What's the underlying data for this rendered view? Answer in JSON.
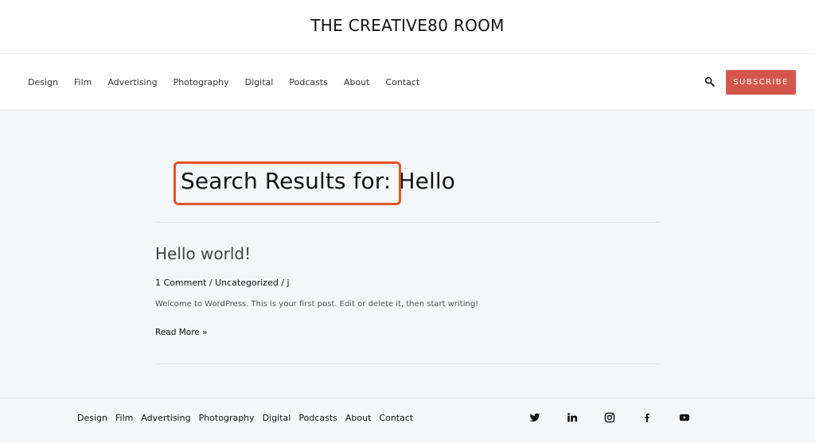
{
  "site": {
    "title": "THE CREATIVE80 ROOM"
  },
  "nav": {
    "items": [
      {
        "label": "Design"
      },
      {
        "label": "Film"
      },
      {
        "label": "Advertising"
      },
      {
        "label": "Photography"
      },
      {
        "label": "Digital"
      },
      {
        "label": "Podcasts"
      },
      {
        "label": "About"
      },
      {
        "label": "Contact"
      }
    ],
    "search_icon": "search-icon",
    "subscribe_label": "SUBSCRIBE"
  },
  "search": {
    "heading_prefix": "Search Results for:",
    "query": "Hello"
  },
  "results": [
    {
      "title": "Hello world!",
      "comments": "1 Comment",
      "category": "Uncategorized",
      "author": "j",
      "separator": "/",
      "excerpt": "Welcome to WordPress. This is your first post. Edit or delete it, then start writing!",
      "read_more": "Read More »"
    }
  ],
  "footer": {
    "items": [
      {
        "label": "Design"
      },
      {
        "label": "Film"
      },
      {
        "label": "Advertising"
      },
      {
        "label": "Photography"
      },
      {
        "label": "Digital"
      },
      {
        "label": "Podcasts"
      },
      {
        "label": "About"
      },
      {
        "label": "Contact"
      }
    ],
    "social": [
      {
        "icon": "twitter-icon"
      },
      {
        "icon": "linkedin-icon"
      },
      {
        "icon": "instagram-icon"
      },
      {
        "icon": "facebook-icon"
      },
      {
        "icon": "youtube-icon"
      }
    ]
  },
  "colors": {
    "accent": "#d4574b",
    "highlight": "#e0542a",
    "background": "#f5f6f8"
  }
}
